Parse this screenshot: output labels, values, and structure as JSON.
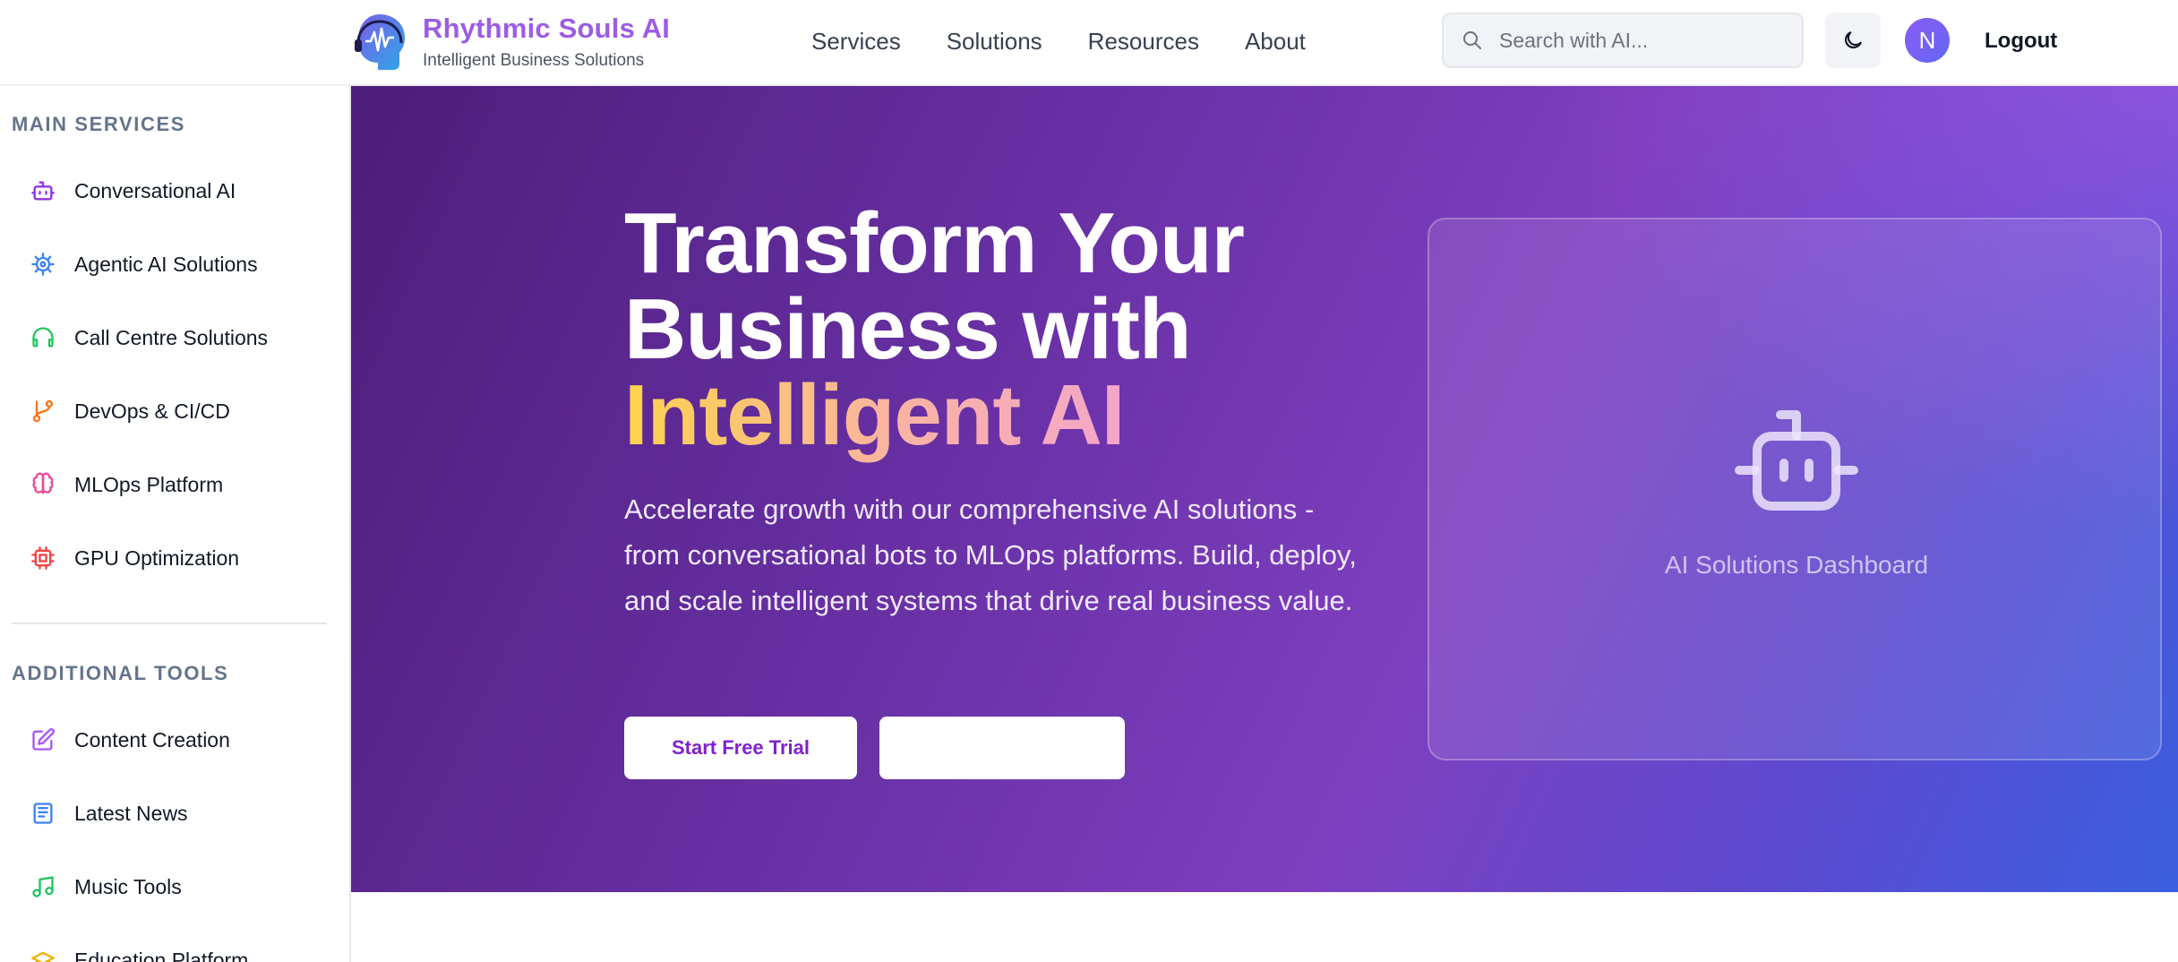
{
  "header": {
    "brand_title": "Rhythmic Souls AI",
    "brand_subtitle": "Intelligent Business Solutions",
    "nav": [
      "Services",
      "Solutions",
      "Resources",
      "About"
    ],
    "search_placeholder": "Search with AI...",
    "avatar_initial": "N",
    "logout_label": "Logout"
  },
  "sidebar": {
    "main_title": "MAIN SERVICES",
    "main_items": [
      {
        "label": "Conversational AI",
        "icon": "bot-icon",
        "color": "#9333ea"
      },
      {
        "label": "Agentic AI Solutions",
        "icon": "gear-icon",
        "color": "#3b82f6"
      },
      {
        "label": "Call Centre Solutions",
        "icon": "headphones-icon",
        "color": "#22c55e"
      },
      {
        "label": "DevOps & CI/CD",
        "icon": "git-branch-icon",
        "color": "#f97316"
      },
      {
        "label": "MLOps Platform",
        "icon": "brain-icon",
        "color": "#ec4899"
      },
      {
        "label": "GPU Optimization",
        "icon": "cpu-icon",
        "color": "#ef4444"
      }
    ],
    "tools_title": "ADDITIONAL TOOLS",
    "tools_items": [
      {
        "label": "Content Creation",
        "icon": "edit-icon",
        "color": "#a855f7"
      },
      {
        "label": "Latest News",
        "icon": "newspaper-icon",
        "color": "#3b82f6"
      },
      {
        "label": "Music Tools",
        "icon": "music-icon",
        "color": "#22c55e"
      },
      {
        "label": "Education Platform",
        "icon": "graduation-cap-icon",
        "color": "#eab308"
      }
    ]
  },
  "hero": {
    "title_line1": "Transform Your",
    "title_line2": "Business with",
    "title_accent": "Intelligent AI",
    "description": "Accelerate growth with our comprehensive AI solutions - from conversational bots to MLOps platforms. Build, deploy, and scale intelligent systems that drive real business value.",
    "primary_button": "Start Free Trial",
    "secondary_button": "",
    "dashboard_label": "AI Solutions Dashboard"
  }
}
